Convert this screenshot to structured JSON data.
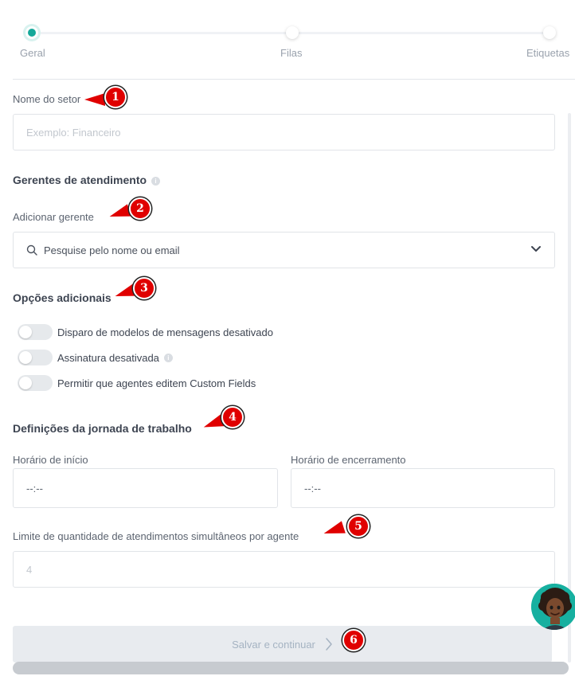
{
  "stepper": {
    "steps": [
      {
        "label": "Geral",
        "state": "active"
      },
      {
        "label": "Filas",
        "state": "pending"
      },
      {
        "label": "Etiquetas",
        "state": "pending"
      }
    ],
    "accent": "#15a99a"
  },
  "sector": {
    "label": "Nome do setor",
    "placeholder": "Exemplo: Financeiro"
  },
  "managers": {
    "title": "Gerentes de atendimento",
    "add_label": "Adicionar gerente",
    "search_placeholder": "Pesquise pelo nome ou email"
  },
  "options": {
    "title": "Opções adicionais",
    "toggles": [
      {
        "label": "Disparo de modelos de mensagens desativado",
        "on": false,
        "info": false
      },
      {
        "label": "Assinatura desativada",
        "on": false,
        "info": true
      },
      {
        "label": "Permitir que agentes editem Custom Fields",
        "on": false,
        "info": false
      }
    ]
  },
  "workday": {
    "title": "Definições da jornada de trabalho",
    "start_label": "Horário de início",
    "start_value": "--:--",
    "end_label": "Horário de encerramento",
    "end_value": "--:--"
  },
  "limit": {
    "label": "Limite de quantidade de atendimentos simultâneos por agente",
    "value": "4"
  },
  "actions": {
    "save_label": "Salvar e continuar"
  },
  "annotations": [
    "1",
    "2",
    "3",
    "4",
    "5",
    "6"
  ],
  "colors": {
    "annotation": "#e00000",
    "button_bg": "#e8ebef",
    "button_text": "#a5b3c2"
  }
}
